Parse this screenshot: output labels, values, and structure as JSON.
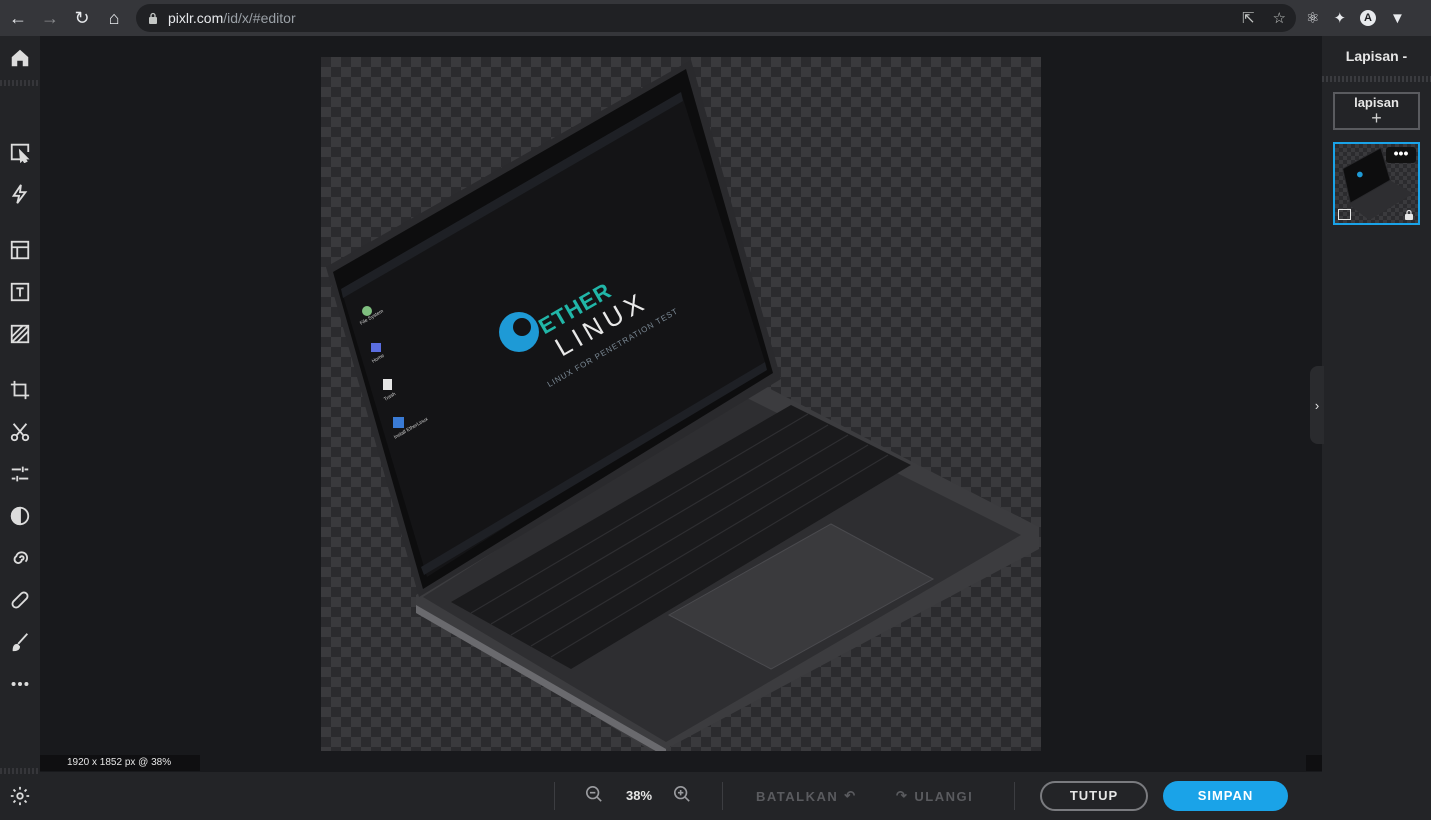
{
  "browser": {
    "url_host": "pixlr.com",
    "url_path": "/id/x/#editor",
    "extension_badge": "A"
  },
  "toolbar": {
    "tools": [
      "home-icon",
      "arrange-icon",
      "quick-select-icon",
      "layout-icon",
      "text-icon",
      "fill-icon",
      "crop-icon",
      "cutout-icon",
      "adjust-icon",
      "contrast-icon",
      "liquify-icon",
      "heal-icon",
      "brush-icon",
      "more-icon",
      "settings-icon"
    ]
  },
  "canvas": {
    "status": "1920 x 1852 px @ 38%",
    "artwork": {
      "brand_top": "ETHER",
      "brand_main": "LINUX",
      "brand_tagline": "LINUX FOR PENETRATION TEST",
      "desktop_icons": [
        "File System",
        "Home",
        "Trash",
        "Install EtherLinux"
      ]
    }
  },
  "layers_panel": {
    "title": "Lapisan -",
    "add_label": "lapisan",
    "add_symbol": "+",
    "layer_menu": "•••"
  },
  "bottom_bar": {
    "zoom": "38%",
    "undo_label": "BATALKAN",
    "redo_label": "ULANGI",
    "close_label": "TUTUP",
    "save_label": "SIMPAN"
  },
  "colors": {
    "accent": "#1aa3e8",
    "toolbar_bg": "#232427",
    "workspace_bg": "#18191c"
  }
}
